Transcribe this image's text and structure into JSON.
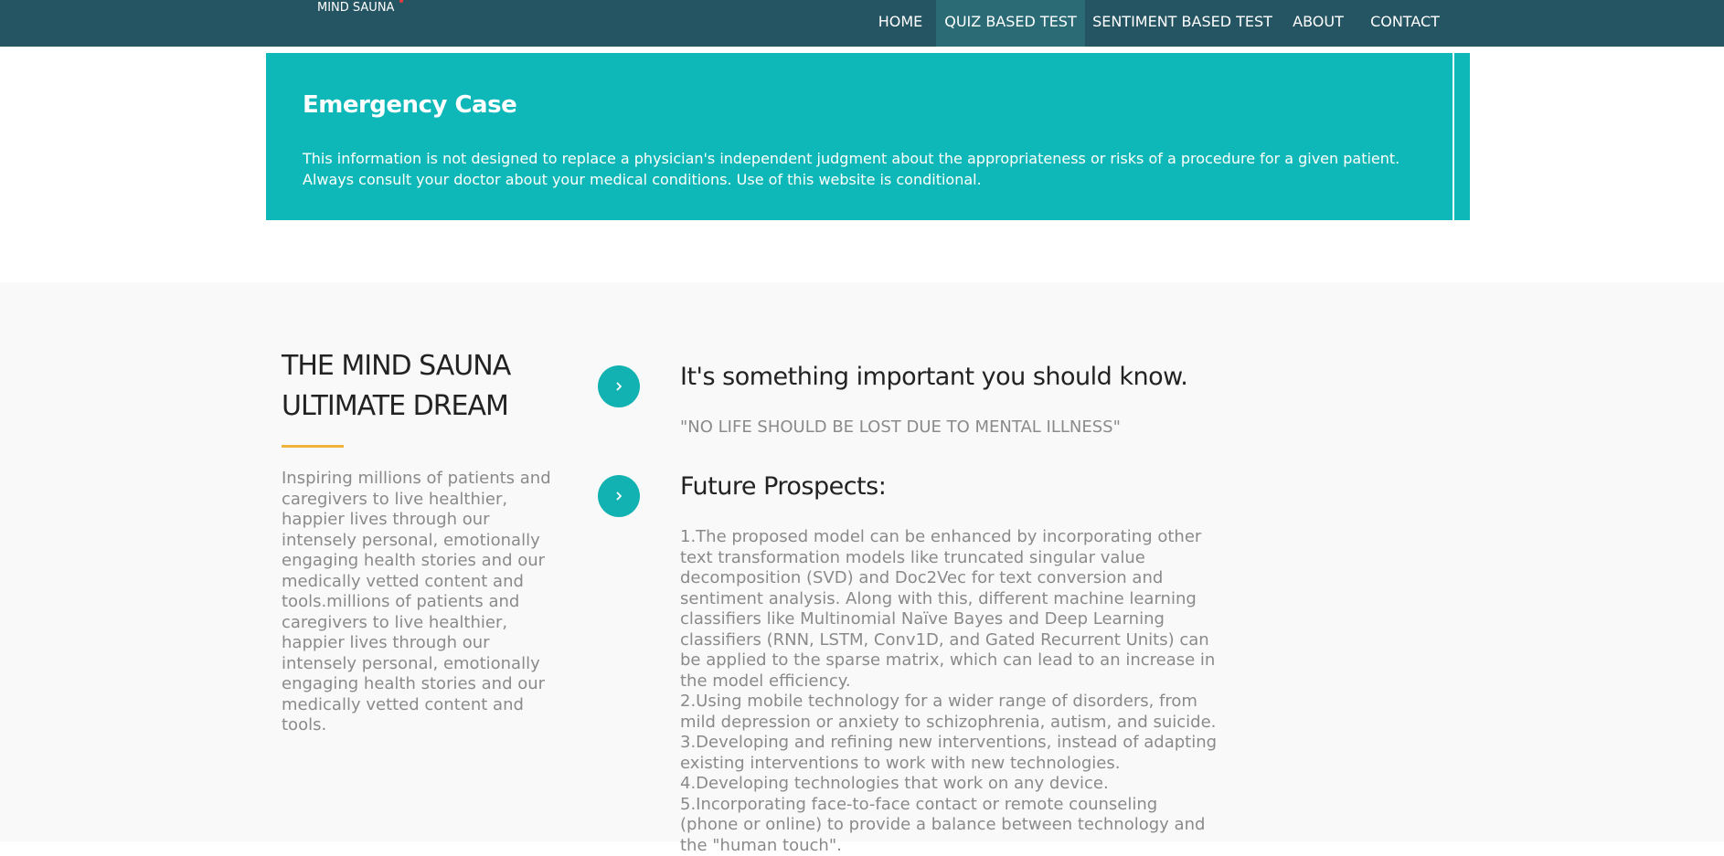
{
  "header": {
    "logo_text": "MIND SAUNA",
    "nav": [
      {
        "label": "HOME"
      },
      {
        "label": "QUIZ BASED TEST"
      },
      {
        "label": "SENTIMENT BASED TEST"
      },
      {
        "label": "ABOUT"
      },
      {
        "label": "CONTACT"
      }
    ],
    "active_nav": "QUIZ BASED TEST"
  },
  "banner": {
    "title": "Emergency Case",
    "text": "This information is not designed to replace a physician's independent judgment about the appropriateness or risks of a procedure for a given patient. Always consult your doctor about your medical conditions. Use of this website is conditional."
  },
  "dream": {
    "title": "THE MIND SAUNA ULTIMATE DREAM",
    "text": "Inspiring millions of patients and caregivers to live healthier, happier lives through our intensely personal, emotionally engaging health stories and our medically vetted content and tools.millions of patients and caregivers to live healthier, happier lives through our intensely personal, emotionally engaging health stories and our medically vetted content and tools."
  },
  "info": {
    "heading": "It's something important you should know.",
    "quote": "\"NO LIFE SHOULD BE LOST DUE TO MENTAL ILLNESS\""
  },
  "prospects": {
    "heading": "Future Prospects:",
    "items": [
      "1.The proposed model can be enhanced by incorporating other text transformation models like truncated singular value decomposition (SVD) and Doc2Vec for text conversion and sentiment analysis. Along with this, different machine learning classifiers like Multinomial Naïve Bayes and Deep Learning classifiers (RNN, LSTM, Conv1D, and Gated Recurrent Units) can be applied to the sparse matrix, which can lead to an increase in the model efficiency.",
      "2.Using mobile technology for a wider range of disorders, from mild depression or anxiety to schizophrenia, autism, and suicide.",
      "3.Developing and refining new interventions, instead of adapting existing interventions to work with new technologies.",
      "4.Developing technologies that work on any device.",
      "5.Incorporating face-to-face contact or remote counseling (phone or online) to provide a balance between technology and the \"human touch\"."
    ]
  },
  "colors": {
    "navbar": "#255463",
    "nav_active": "#2a6b76",
    "banner": "#0fb8b8",
    "accent_circle": "#13b2b2",
    "underline": "#f0b33a",
    "section_bg": "#f9f9f9"
  },
  "icons": {
    "circle_button_icon": "chevron-right-icon"
  }
}
